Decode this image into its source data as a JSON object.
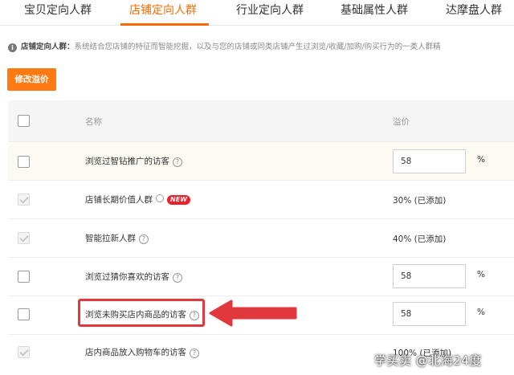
{
  "tabs": [
    {
      "label": "宝贝定向人群",
      "active": false
    },
    {
      "label": "店铺定向人群",
      "active": true
    },
    {
      "label": "行业定向人群",
      "active": false
    },
    {
      "label": "基础属性人群",
      "active": false
    },
    {
      "label": "达摩盘人群",
      "active": false
    }
  ],
  "info": {
    "title": "店铺定向人群：",
    "text": "系统结合您店铺的特征而智能挖掘，以及与您的店铺或同类店铺产生过浏览/收藏/加购/购买行为的一类人群精"
  },
  "toolbar": {
    "edit_label": "修改溢价"
  },
  "table": {
    "headers": {
      "name": "名称",
      "price": "溢价"
    },
    "rows": [
      {
        "name": "浏览过智钻推广的访客",
        "checked": false,
        "disabled": false,
        "price": "58",
        "unit": "%",
        "has_input": true,
        "help": "?",
        "badge": ""
      },
      {
        "name": "店铺长期价值人群",
        "checked": true,
        "disabled": true,
        "price": "30% (已添加)",
        "has_input": false,
        "help": "",
        "badge": "NEW"
      },
      {
        "name": "智能拉新人群",
        "checked": true,
        "disabled": true,
        "price": "40% (已添加)",
        "has_input": false,
        "help": "?",
        "badge": ""
      },
      {
        "name": "浏览过猜你喜欢的访客",
        "checked": false,
        "disabled": false,
        "price": "58",
        "unit": "%",
        "has_input": true,
        "help": "?",
        "badge": ""
      },
      {
        "name": "浏览未购买店内商品的访客",
        "checked": false,
        "disabled": false,
        "price": "58",
        "unit": "%",
        "has_input": true,
        "help": "?",
        "badge": ""
      },
      {
        "name": "店内商品放入购物车的访客",
        "checked": true,
        "disabled": true,
        "price": "100% (已添加)",
        "has_input": false,
        "help": "?",
        "badge": ""
      }
    ]
  },
  "colors": {
    "accent": "#ff6a00",
    "button": "#ff7a12",
    "highlight": "#e0383d",
    "badge": "#e8232e"
  },
  "watermark": "学买卖 @北海24度"
}
